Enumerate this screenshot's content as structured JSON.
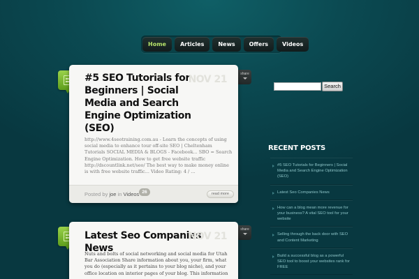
{
  "nav": {
    "items": [
      {
        "label": "Home",
        "active": true
      },
      {
        "label": "Articles"
      },
      {
        "label": "News"
      },
      {
        "label": "Offers"
      },
      {
        "label": "Videos"
      }
    ]
  },
  "posts": [
    {
      "title": "#5 SEO Tutorials for Beginners | Social Media and Search Engine Optimization (SEO)",
      "date": "NOV 21",
      "excerpt": "http://www.4seotraining.com.au - Learn the concepts of using social media to enhance tour off-site SEO | Cheltenham Tutorials SOCIAL MEDIA & BLOGS - Facebook... SBO = Search Engine Optimization. How to get free website traffic http://dscountlink.net/seo/ The best way to make money online is with free website traffic... Video Rating: 4 / ...",
      "posted_by": "Posted by",
      "author": "joe",
      "in": "in",
      "category": "Videos",
      "comments": "26",
      "read_more": "read more",
      "share": "share"
    },
    {
      "title": "Latest Seo Companies News",
      "date": "NOV 21",
      "excerpt": "Nuts and bolts of social networking and social media for Utah Bar Association Share information about you, your firm, what you do (especially as it pertains to your blog niche), and your office location on interior pages of your blog. This information ...",
      "share": "share"
    }
  ],
  "sidebar": {
    "search_placeholder": "",
    "search_button": "Search",
    "recent_title": "RECENT POSTS",
    "recent_posts": [
      "#5 SEO Tutorials for Beginners | Social Media and Search Engine Optimization (SEO)",
      "Latest Seo Companies News",
      "How can a blog mean more revenue for your business? A vital SEO tool for your website",
      "Selling through the back door with SEO and Content Marketing",
      "Build a successful blog as a powerful SEO tool to boost your websites rank for FREE"
    ]
  },
  "colors": {
    "background": "#0b4a52",
    "accent_green": "#7fbf35",
    "nav_active": "#b6e36a"
  }
}
